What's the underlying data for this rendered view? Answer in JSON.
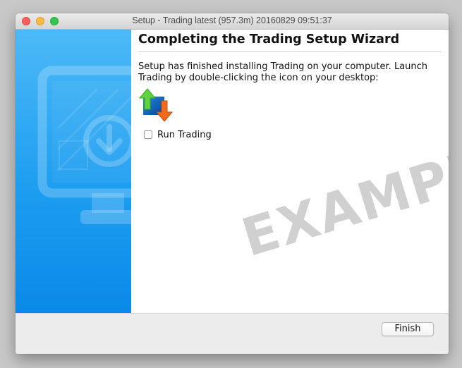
{
  "window": {
    "title": "Setup - Trading latest (957.3m) 20160829 09:51:37"
  },
  "wizard": {
    "heading": "Completing the Trading Setup Wizard",
    "description": "Setup has finished installing Trading on your computer. Launch Trading by double-clicking the icon on your desktop:",
    "app_icon": "trading-app-icon",
    "run_checkbox": {
      "label": "Run Trading",
      "checked": false
    }
  },
  "watermark": "EXAMPLE",
  "footer": {
    "finish_label": "Finish"
  },
  "colors": {
    "sidebar_top": "#4db9f7",
    "sidebar_bottom": "#0a8ae8",
    "close": "#fc605c",
    "minimize": "#fdbc40",
    "maximize": "#34c84a"
  }
}
